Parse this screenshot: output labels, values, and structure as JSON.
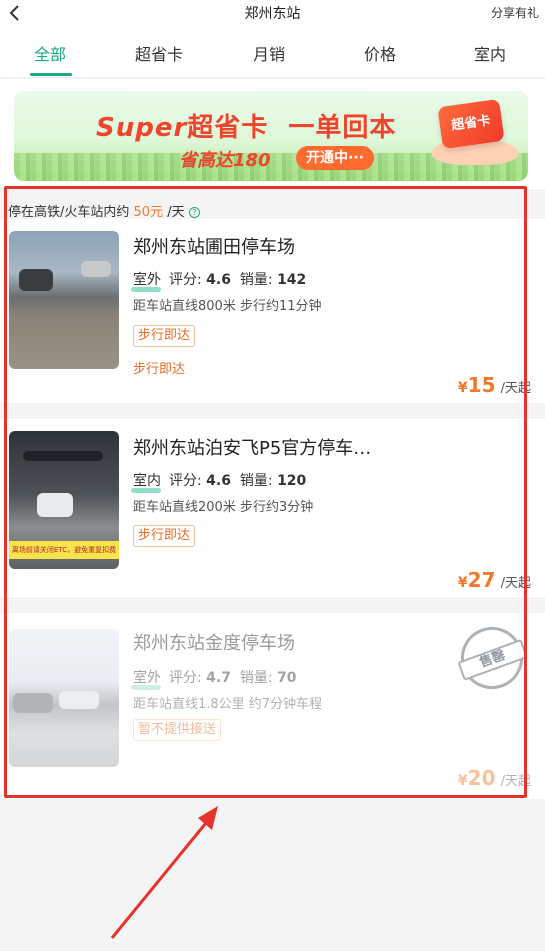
{
  "header": {
    "title": "郑州东站",
    "share_label": "分享有礼",
    "back_icon": "chevron-left-icon"
  },
  "tabs": [
    {
      "label": "全部",
      "active": true
    },
    {
      "label": "超省卡",
      "active": false
    },
    {
      "label": "月销",
      "active": false
    },
    {
      "label": "价格",
      "active": false
    },
    {
      "label": "室内",
      "active": false
    }
  ],
  "banner": {
    "brand_latin": "Super",
    "brand_cn": "超省卡",
    "headline": "一单回本",
    "sub": "省高达180",
    "pill": "开通中···",
    "card_label": "超省卡"
  },
  "note": {
    "prefix": "停在高铁/火车站内约",
    "price": "50元",
    "suffix": "/天",
    "help_icon": "question-circle-icon"
  },
  "parkings": [
    {
      "name": "郑州东站圃田停车场",
      "env": "室外",
      "rating_label": "评分:",
      "rating": "4.6",
      "sales_label": "销量:",
      "sales": "142",
      "distance": "距车站直线800米 步行约11分钟",
      "tag": "步行即达",
      "extra": "步行即达",
      "yen": "¥",
      "price": "15",
      "unit": "/天起"
    },
    {
      "name": "郑州东站泊安飞P5官方停车…",
      "env": "室内",
      "rating_label": "评分:",
      "rating": "4.6",
      "sales_label": "销量:",
      "sales": "120",
      "distance": "距车站直线200米 步行约3分钟",
      "tag": "步行即达",
      "photo_caption": "离场前请关闭ETC，避免重复扣费",
      "yen": "¥",
      "price": "27",
      "unit": "/天起"
    },
    {
      "name": "郑州东站金度停车场",
      "env": "室外",
      "rating_label": "评分:",
      "rating": "4.7",
      "sales_label": "销量:",
      "sales": "70",
      "distance": "距车站直线1.8公里 约7分钟车程",
      "tag": "暂不提供接送",
      "sold_out": "售罄",
      "yen": "¥",
      "price": "20",
      "unit": "/天起"
    }
  ],
  "colors": {
    "accent": "#1aa886",
    "price": "#f07a2b",
    "highlight_box": "#e5322b"
  }
}
